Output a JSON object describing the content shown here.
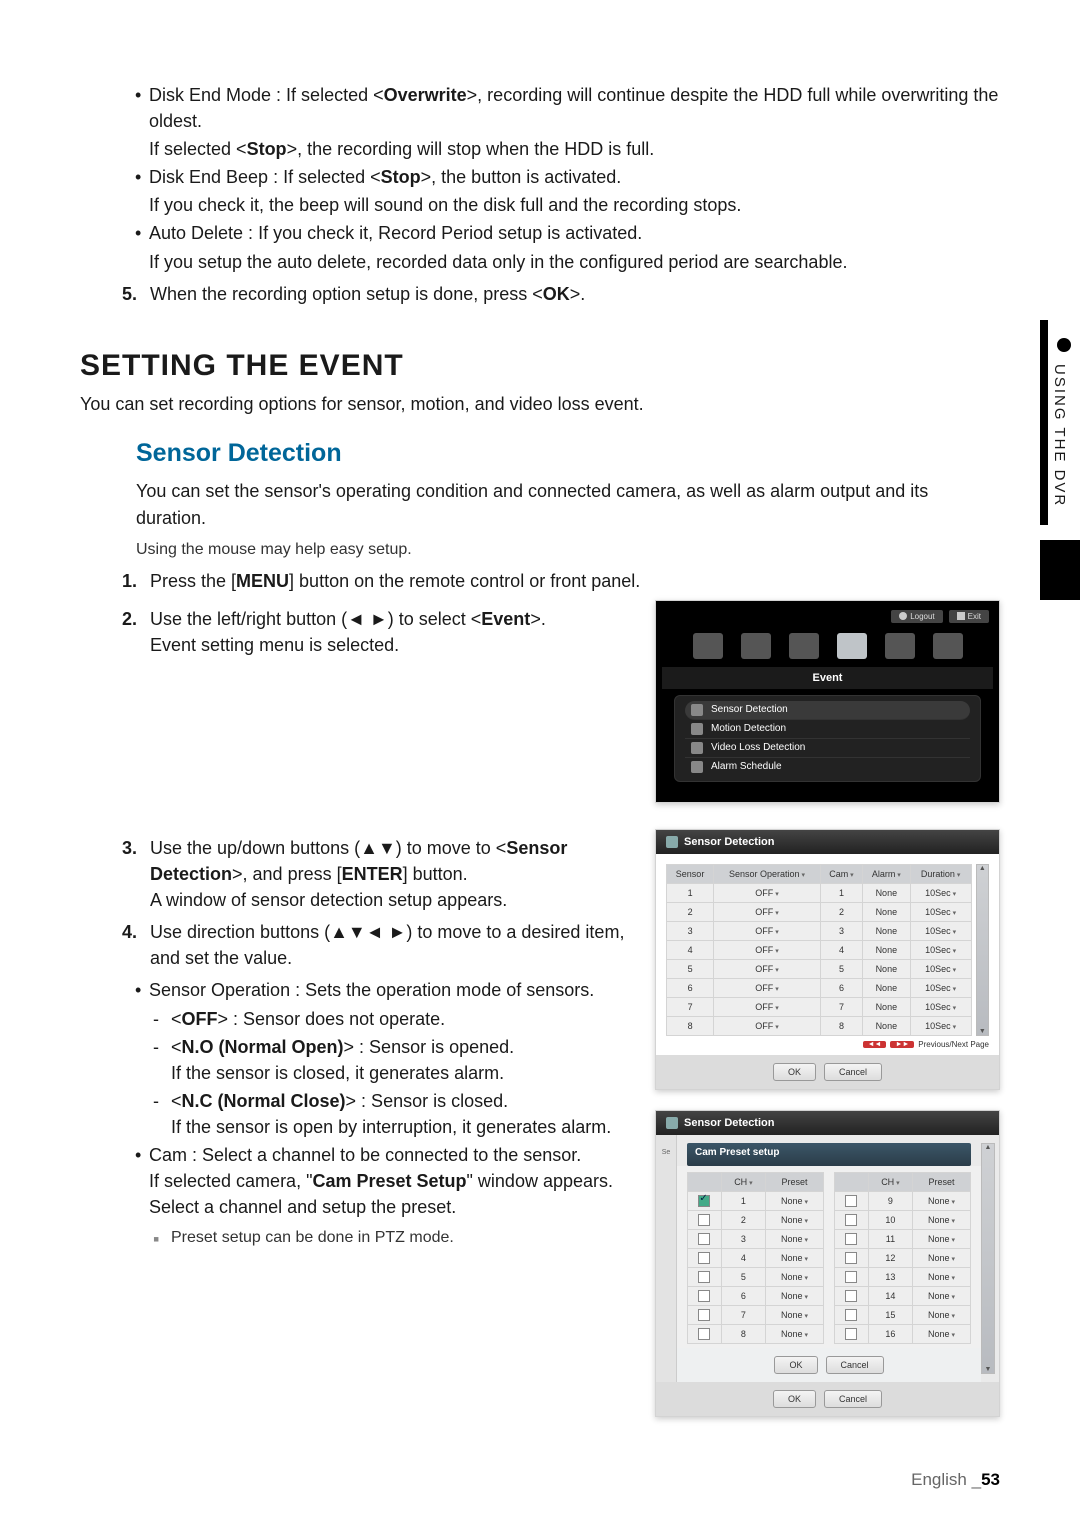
{
  "top_bullets": {
    "b1_line1_a": "Disk End Mode : If selected <",
    "b1_line1_b": "Overwrite",
    "b1_line1_c": ">, recording will continue despite the HDD full while overwriting the oldest.",
    "b1_sub_a": "If selected <",
    "b1_sub_b": "Stop",
    "b1_sub_c": ">, the recording will stop when the HDD is full.",
    "b2_line1_a": "Disk End Beep : If selected <",
    "b2_line1_b": "Stop",
    "b2_line1_c": ">, the button is activated.",
    "b2_sub": "If you check it, the beep will sound on the disk full and the recording stops.",
    "b3_line1": "Auto Delete : If you check it, Record Period setup is activated.",
    "b3_sub": "If you setup the auto delete, recorded data only in the configured period are searchable."
  },
  "step5_a": "When the recording option setup is done, press <",
  "step5_b": "OK",
  "step5_c": ">.",
  "h1": "SETTING THE EVENT",
  "lead": "You can set recording options for sensor, motion, and video loss event.",
  "h2": "Sensor Detection",
  "para1": "You can set the sensor's operating condition and connected camera, as well as alarm output and its duration.",
  "para2": "Using the mouse may help easy setup.",
  "step1_a": "Press the [",
  "step1_b": "MENU",
  "step1_c": "] button on the remote control or front panel.",
  "step2_a": "Use the left/right button (◄ ►) to select <",
  "step2_b": "Event",
  "step2_c": ">.",
  "step2_sub": "Event setting menu is selected.",
  "step3_a": "Use the up/down buttons (▲▼) to move to <",
  "step3_b": "Sensor Detection",
  "step3_c": ">, and press [",
  "step3_d": "ENTER",
  "step3_e": "] button.",
  "step3_sub": "A window of sensor detection setup appears.",
  "step4": "Use direction buttons (▲▼◄ ►) to move to a desired item, and set the value.",
  "sop_lead": "Sensor Operation : Sets the operation mode of sensors.",
  "sop_off_a": "<",
  "sop_off_b": "OFF",
  "sop_off_c": "> : Sensor does not operate.",
  "sop_no_a": "<",
  "sop_no_b": "N.O (Normal Open)",
  "sop_no_c": "> : Sensor is opened.",
  "sop_no_sub": "If the sensor is closed, it generates alarm.",
  "sop_nc_a": "<",
  "sop_nc_b": "N.C (Normal Close)",
  "sop_nc_c": "> : Sensor is closed.",
  "sop_nc_sub": "If the sensor is open by interruption, it generates alarm.",
  "cam_l1": "Cam : Select a channel to be connected to the sensor.",
  "cam_l2_a": "If selected camera, \"",
  "cam_l2_b": "Cam Preset Setup",
  "cam_l2_c": "\" window appears.",
  "cam_l3": "Select a channel and setup the preset.",
  "cam_note": "Preset setup can be done in PTZ mode.",
  "sidetab": "USING THE DVR",
  "footer_lang": "English",
  "footer_sep": "_",
  "footer_page": "53",
  "shot1": {
    "logout": "Logout",
    "exit": "Exit",
    "section": "Event",
    "items": [
      "Sensor Detection",
      "Motion Detection",
      "Video Loss Detection",
      "Alarm Schedule"
    ]
  },
  "shot2": {
    "title": "Sensor Detection",
    "cols": [
      "Sensor",
      "Sensor Operation",
      "Cam",
      "Alarm",
      "Duration"
    ],
    "rows": [
      {
        "n": "1",
        "op": "OFF",
        "cam": "1",
        "alarm": "None",
        "dur": "10Sec"
      },
      {
        "n": "2",
        "op": "OFF",
        "cam": "2",
        "alarm": "None",
        "dur": "10Sec"
      },
      {
        "n": "3",
        "op": "OFF",
        "cam": "3",
        "alarm": "None",
        "dur": "10Sec"
      },
      {
        "n": "4",
        "op": "OFF",
        "cam": "4",
        "alarm": "None",
        "dur": "10Sec"
      },
      {
        "n": "5",
        "op": "OFF",
        "cam": "5",
        "alarm": "None",
        "dur": "10Sec"
      },
      {
        "n": "6",
        "op": "OFF",
        "cam": "6",
        "alarm": "None",
        "dur": "10Sec"
      },
      {
        "n": "7",
        "op": "OFF",
        "cam": "7",
        "alarm": "None",
        "dur": "10Sec"
      },
      {
        "n": "8",
        "op": "OFF",
        "cam": "8",
        "alarm": "None",
        "dur": "10Sec"
      }
    ],
    "prevnext": "Previous/Next Page",
    "ok": "OK",
    "cancel": "Cancel"
  },
  "shot3": {
    "title": "Sensor Detection",
    "panel": "Cam Preset setup",
    "col_ch": "CH",
    "col_preset": "Preset",
    "left": [
      {
        "c": true,
        "n": "1",
        "p": "None"
      },
      {
        "c": false,
        "n": "2",
        "p": "None"
      },
      {
        "c": false,
        "n": "3",
        "p": "None"
      },
      {
        "c": false,
        "n": "4",
        "p": "None"
      },
      {
        "c": false,
        "n": "5",
        "p": "None"
      },
      {
        "c": false,
        "n": "6",
        "p": "None"
      },
      {
        "c": false,
        "n": "7",
        "p": "None"
      },
      {
        "c": false,
        "n": "8",
        "p": "None"
      }
    ],
    "right": [
      {
        "c": false,
        "n": "9",
        "p": "None"
      },
      {
        "c": false,
        "n": "10",
        "p": "None"
      },
      {
        "c": false,
        "n": "11",
        "p": "None"
      },
      {
        "c": false,
        "n": "12",
        "p": "None"
      },
      {
        "c": false,
        "n": "13",
        "p": "None"
      },
      {
        "c": false,
        "n": "14",
        "p": "None"
      },
      {
        "c": false,
        "n": "15",
        "p": "None"
      },
      {
        "c": false,
        "n": "16",
        "p": "None"
      }
    ],
    "ok": "OK",
    "cancel": "Cancel"
  }
}
